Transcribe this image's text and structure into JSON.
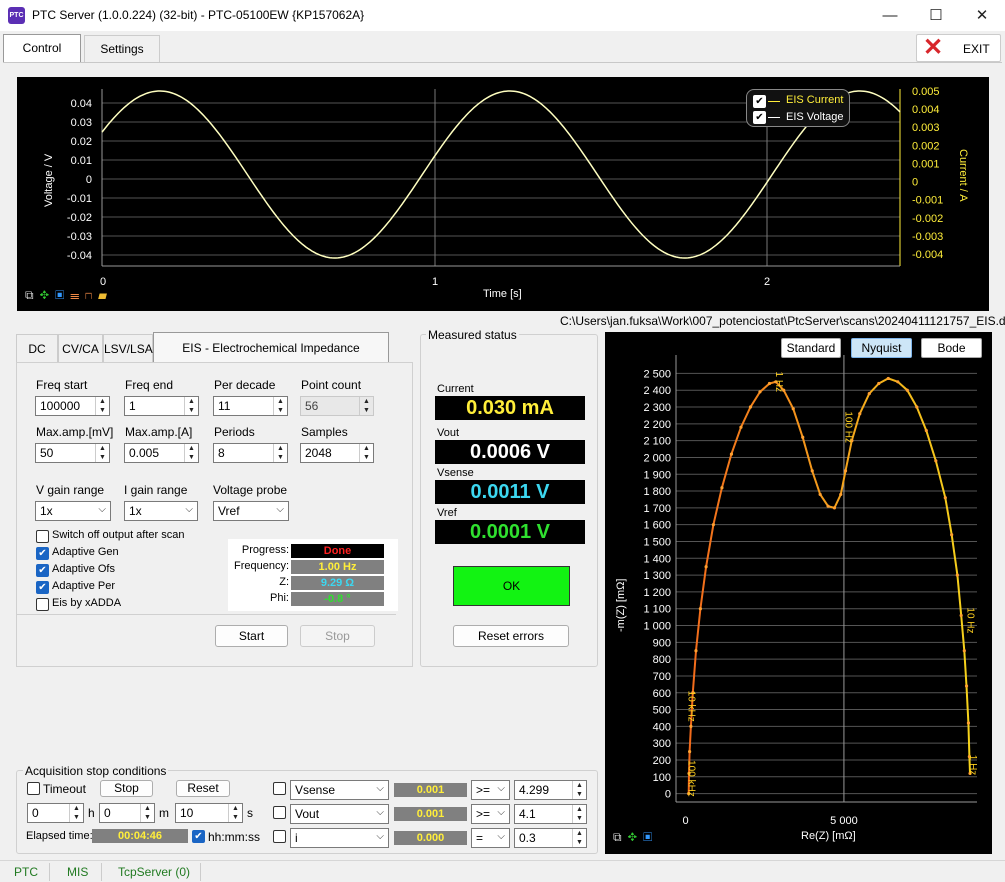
{
  "window": {
    "title": "PTC Server (1.0.0.224) (32-bit) - PTC-05100EW {KP157062A}",
    "icon_text": "PTC",
    "minimize": "—",
    "maximize": "☐",
    "close": "✕"
  },
  "top_tabs": [
    {
      "label": "Control",
      "active": true
    },
    {
      "label": "Settings",
      "active": false
    }
  ],
  "exit_button": {
    "label": "EXIT",
    "icon": "red-x-icon"
  },
  "waveform": {
    "ylabel_left": "Voltage / V",
    "ylabel_right": "Current / A",
    "xlabel": "Time [s]",
    "yticks_left": [
      "0.04",
      "0.03",
      "0.02",
      "0.01",
      "0",
      "-0.01",
      "-0.02",
      "-0.03",
      "-0.04"
    ],
    "yticks_right": [
      "0.005",
      "0.004",
      "0.003",
      "0.002",
      "0.001",
      "0",
      "-0.001",
      "-0.002",
      "-0.003",
      "-0.004"
    ],
    "xticks": [
      "0",
      "1",
      "2"
    ],
    "legend": [
      {
        "label": "EIS Current",
        "checked": true,
        "color": "#ffee3a"
      },
      {
        "label": "EIS Voltage",
        "checked": true,
        "color": "#ffffff"
      }
    ],
    "toolbar_icons": [
      "copy-icon",
      "fit-icon",
      "save-icon",
      "markers-icon",
      "step-icon",
      "open-folder-icon"
    ]
  },
  "file_path": "C:\\Users\\jan.fuksa\\Work\\007_potenciostat\\PtcServer\\scans\\20240411121757_EIS.dat",
  "mode_tabs": [
    {
      "label": "DC"
    },
    {
      "label": "CV/CA"
    },
    {
      "label": "LSV/LSA"
    },
    {
      "label": "EIS - Electrochemical Impedance Spectroscopy",
      "active": true
    }
  ],
  "eis": {
    "fields": [
      {
        "label": "Freq start",
        "value": "100000"
      },
      {
        "label": "Freq end",
        "value": "1"
      },
      {
        "label": "Per decade",
        "value": "11"
      },
      {
        "label": "Point count",
        "value": "56"
      },
      {
        "label": "Max.amp.[mV]",
        "value": "50"
      },
      {
        "label": "Max.amp.[A]",
        "value": "0.005"
      },
      {
        "label": "Periods",
        "value": "8"
      },
      {
        "label": "Samples",
        "value": "2048"
      }
    ],
    "selects": [
      {
        "label": "V gain range",
        "value": "1x"
      },
      {
        "label": "I gain range",
        "value": "1x"
      },
      {
        "label": "Voltage probe",
        "value": "Vref"
      }
    ],
    "checks": [
      {
        "label": "Switch off output after scan",
        "checked": false
      },
      {
        "label": "Adaptive Gen",
        "checked": true
      },
      {
        "label": "Adaptive Ofs",
        "checked": true
      },
      {
        "label": "Adaptive Per",
        "checked": true
      },
      {
        "label": "Eis by xADDA",
        "checked": false
      }
    ],
    "progress": [
      {
        "label": "Progress:",
        "value": "Done",
        "color": "#ff2020",
        "bg": "#000000"
      },
      {
        "label": "Frequency:",
        "value": "1.00 Hz",
        "color": "#ffee3a",
        "bg": "#808080"
      },
      {
        "label": "Z:",
        "value": "9.29 Ω",
        "color": "#3cd7f0",
        "bg": "#808080"
      },
      {
        "label": "Phi:",
        "value": "-0.8 °",
        "color": "#2fe02f",
        "bg": "#808080"
      }
    ],
    "start": "Start",
    "stop": "Stop"
  },
  "measured": {
    "title": "Measured status",
    "items": [
      {
        "label": "Current",
        "value": "0.030 mA",
        "color": "#ffee3a"
      },
      {
        "label": "Vout",
        "value": "0.0006 V",
        "color": "#ffffff"
      },
      {
        "label": "Vsense",
        "value": "0.0011 V",
        "color": "#3cd7f0"
      },
      {
        "label": "Vref",
        "value": "0.0001 V",
        "color": "#2fe02f"
      }
    ],
    "ok": "OK",
    "reset": "Reset errors"
  },
  "acq": {
    "title": "Acquisition stop conditions",
    "timeout": "Timeout",
    "stop": "Stop",
    "reset": "Reset",
    "h_val": "0",
    "h_unit": "h",
    "m_val": "0",
    "m_unit": "m",
    "s_val": "10",
    "s_unit": "s",
    "elapsed_label": "Elapsed time:",
    "elapsed": "00:04:46",
    "hhmmss": "hh:mm:ss",
    "rows": [
      {
        "signal": "Vsense",
        "value": "0.001",
        "op": ">=",
        "limit": "4.299"
      },
      {
        "signal": "Vout",
        "value": "0.001",
        "op": ">=",
        "limit": "4.1"
      },
      {
        "signal": "i",
        "value": "0.000",
        "op": "=",
        "limit": "0.3"
      }
    ]
  },
  "nyquist": {
    "buttons": [
      {
        "label": "Standard"
      },
      {
        "label": "Nyquist",
        "active": true
      },
      {
        "label": "Bode"
      }
    ],
    "ylabel": "-m(Z) [mΩ]",
    "xlabel": "Re(Z) [mΩ]",
    "yticks": [
      "2 500",
      "2 400",
      "2 300",
      "2 200",
      "2 100",
      "2 000",
      "1 900",
      "1 800",
      "1 700",
      "1 600",
      "1 500",
      "1 400",
      "1 300",
      "1 200",
      "1 100",
      "1 000",
      "900",
      "800",
      "700",
      "600",
      "500",
      "400",
      "300",
      "200",
      "100",
      "0"
    ],
    "xticks": [
      "0",
      "5 000"
    ],
    "annotations": [
      "1 Hz",
      "100 Hz",
      "10 Hz",
      "10 kHz",
      "100 kHz",
      "1 Hz"
    ],
    "toolbar_icons": [
      "copy-icon",
      "fit-icon",
      "save-icon"
    ]
  },
  "chart_data": {
    "type": "scatter",
    "xlabel": "Re(Z) [mΩ]",
    "ylabel": "-m(Z) [mΩ]",
    "xlim": [
      -300,
      9200
    ],
    "ylim": [
      -50,
      2550
    ],
    "series": [
      {
        "values": [
          [
            100,
            0
          ],
          [
            110,
            120
          ],
          [
            130,
            250
          ],
          [
            170,
            400
          ],
          [
            230,
            600
          ],
          [
            330,
            850
          ],
          [
            470,
            1100
          ],
          [
            650,
            1350
          ],
          [
            880,
            1600
          ],
          [
            1150,
            1820
          ],
          [
            1450,
            2020
          ],
          [
            1750,
            2180
          ],
          [
            2050,
            2300
          ],
          [
            2350,
            2390
          ],
          [
            2650,
            2440
          ],
          [
            2850,
            2450
          ],
          [
            3100,
            2400
          ],
          [
            3400,
            2290
          ],
          [
            3700,
            2120
          ],
          [
            4000,
            1920
          ],
          [
            4250,
            1780
          ],
          [
            4500,
            1710
          ],
          [
            4700,
            1700
          ],
          [
            4900,
            1780
          ],
          [
            5050,
            1920
          ],
          [
            5250,
            2100
          ],
          [
            5500,
            2260
          ],
          [
            5800,
            2380
          ],
          [
            6100,
            2440
          ],
          [
            6400,
            2470
          ],
          [
            6700,
            2450
          ],
          [
            7000,
            2400
          ],
          [
            7300,
            2300
          ],
          [
            7600,
            2160
          ],
          [
            7900,
            1980
          ],
          [
            8200,
            1760
          ],
          [
            8400,
            1540
          ],
          [
            8580,
            1300
          ],
          [
            8700,
            1060
          ],
          [
            8800,
            850
          ],
          [
            8870,
            640
          ],
          [
            8930,
            420
          ],
          [
            8960,
            220
          ],
          [
            8980,
            120
          ]
        ]
      }
    ]
  },
  "statusbar": [
    {
      "label": "PTC"
    },
    {
      "label": "MIS"
    },
    {
      "label": "TcpServer (0)"
    }
  ]
}
